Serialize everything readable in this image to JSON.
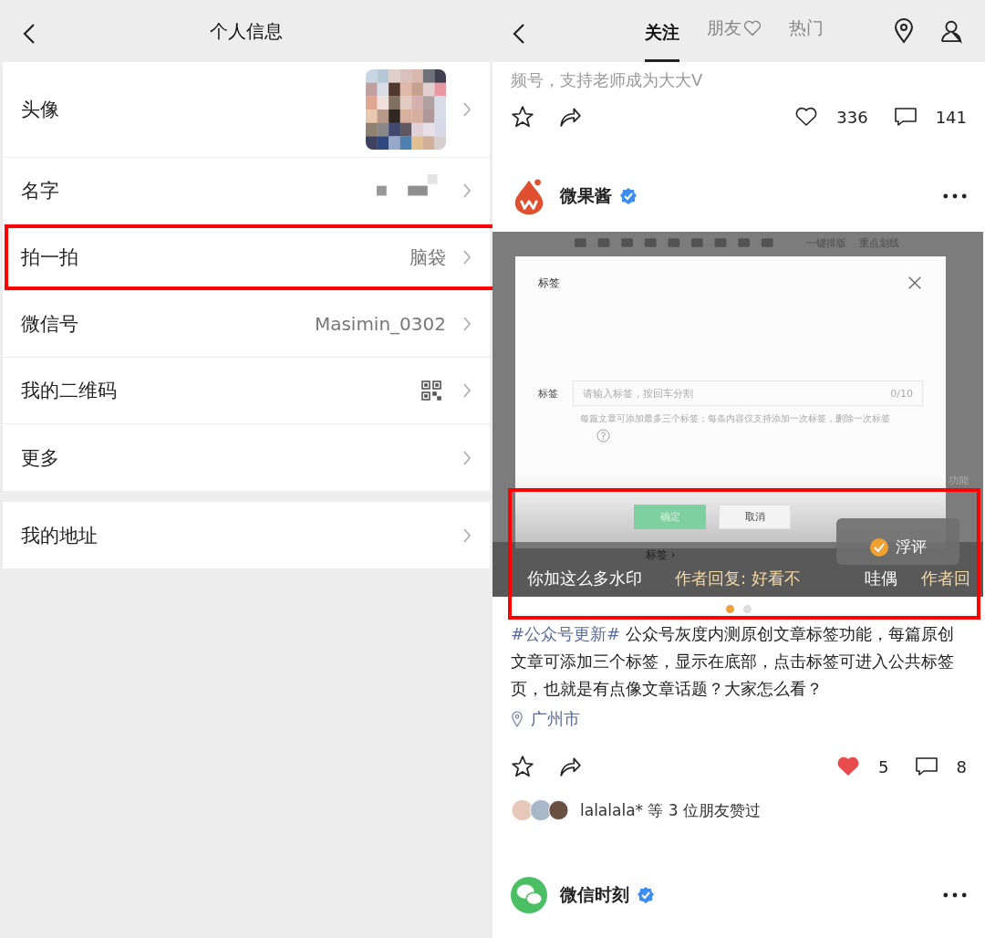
{
  "left": {
    "title": "个人信息",
    "rows": [
      {
        "label": "头像",
        "kind": "avatar",
        "highlighted": false
      },
      {
        "label": "名字",
        "kind": "blurred",
        "highlighted": false
      },
      {
        "label": "拍一拍",
        "kind": "text",
        "value": "脑袋",
        "highlighted": true
      },
      {
        "label": "微信号",
        "kind": "text",
        "value": "Masimin_0302",
        "highlighted": false
      },
      {
        "label": "我的二维码",
        "kind": "qr",
        "highlighted": false
      },
      {
        "label": "更多",
        "kind": "plain",
        "highlighted": false
      }
    ],
    "rows_2": [
      {
        "label": "我的地址",
        "highlighted": false
      }
    ]
  },
  "right": {
    "tabs": [
      {
        "label": "关注",
        "selected": true,
        "heart": false
      },
      {
        "label": "朋友",
        "selected": false,
        "heart": true
      },
      {
        "label": "热门",
        "selected": false,
        "heart": false
      }
    ],
    "prev_post": {
      "text_tail": "频号，支持老师成为大大V",
      "likes": "336",
      "liked": false,
      "comments": "141"
    },
    "post": {
      "author": "微果酱",
      "kind": "drop",
      "verified": true,
      "image": {
        "toolbar_texts": [
          "一键排版",
          "重点划线"
        ],
        "side_text": "功能",
        "dialog": {
          "title": "标签",
          "field_label": "标签",
          "placeholder": "请输入标签，按回车分割",
          "counter": "0/10",
          "hint": "每篇文章可添加最多三个标签；每条内容仅支持添加一次标签，删除一次标签",
          "buttons": [
            {
              "label": "确定",
              "primary": true
            },
            {
              "label": "取消",
              "primary": false
            }
          ]
        },
        "behind_text": "标签 ›",
        "danmaku": [
          {
            "text": "你加这么多水印",
            "kind": "user"
          },
          {
            "text": "作者回复: 好看不",
            "kind": "author"
          },
          {
            "text": "哇偶",
            "kind": "user"
          },
          {
            "text": "作者回",
            "kind": "author"
          }
        ],
        "float_button": "浮评",
        "highlighted": true
      },
      "dots": [
        {
          "selected": true
        },
        {
          "selected": false
        }
      ],
      "hashtag": "#公众号更新#",
      "text": "公众号灰度内测原创文章标签功能，每篇原创文章可添加三个标签，显示在底部，点击标签可进入公共标签页，也就是有点像文章话题？大家怎么看？",
      "location": "广州市",
      "likes": "5",
      "liked": true,
      "comments": "8",
      "liked_by": "lalalala* 等 3 位朋友赞过"
    },
    "next_post": {
      "author": "微信时刻",
      "kind": "chat",
      "verified": true
    }
  }
}
